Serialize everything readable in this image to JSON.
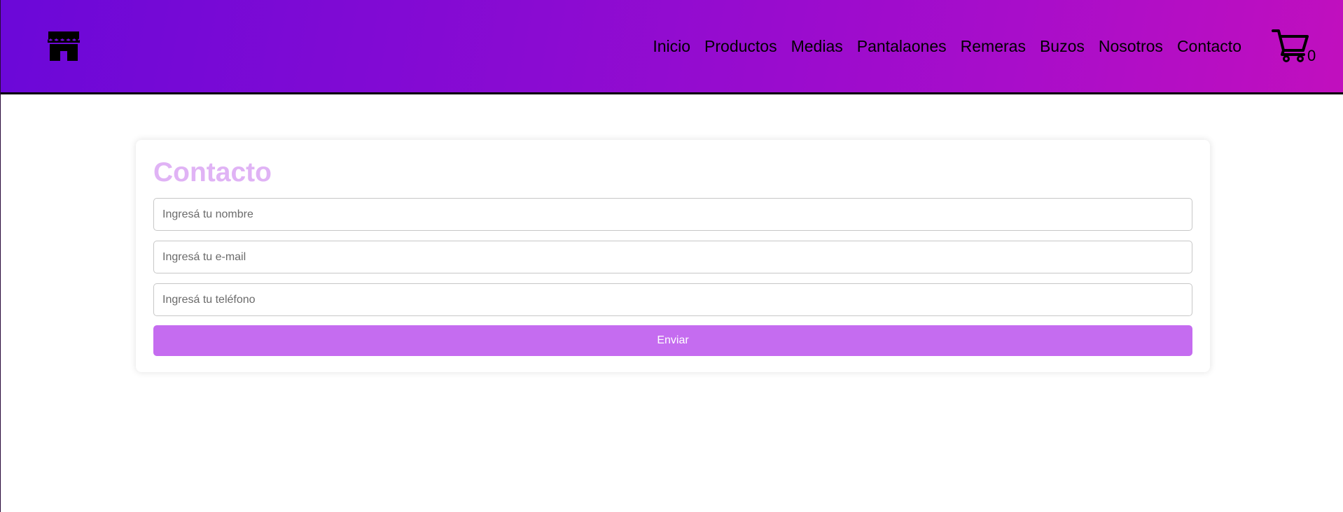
{
  "header": {
    "logo_icon": "store-icon",
    "nav": [
      {
        "label": "Inicio"
      },
      {
        "label": "Productos"
      },
      {
        "label": "Medias"
      },
      {
        "label": "Pantalaones"
      },
      {
        "label": "Remeras"
      },
      {
        "label": "Buzos"
      },
      {
        "label": "Nosotros"
      },
      {
        "label": "Contacto"
      }
    ],
    "cart": {
      "icon": "cart-icon",
      "count": "0"
    },
    "colors": {
      "gradient_start": "#6b08d8",
      "gradient_end": "#c10fbe"
    }
  },
  "contact_form": {
    "title": "Contacto",
    "title_color": "#e0b3f5",
    "fields": [
      {
        "placeholder": "Ingresá tu nombre",
        "value": ""
      },
      {
        "placeholder": "Ingresá tu e-mail",
        "value": ""
      },
      {
        "placeholder": "Ingresá tu teléfono",
        "value": ""
      }
    ],
    "submit_label": "Enviar",
    "submit_color": "#c56cf0"
  }
}
